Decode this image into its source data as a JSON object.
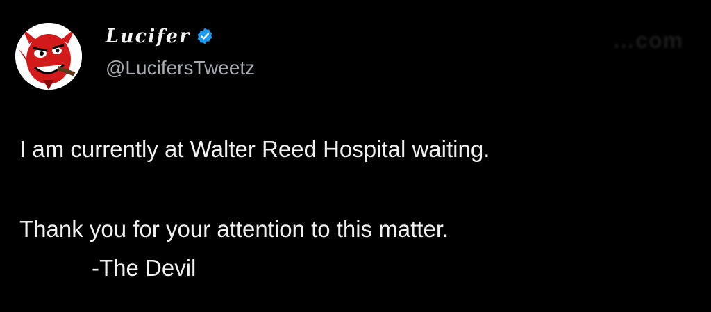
{
  "author": {
    "display_name": "Lucifer",
    "handle": "@LucifersTweetz",
    "avatar_icon": "devil-avatar-icon",
    "verified_icon": "verified-badge-icon",
    "verified_color": "#1d9bf0"
  },
  "watermark": "…com",
  "tweet": {
    "line_1": "I am currently at Walter Reed Hospital waiting.",
    "line_2": "Thank you for your attention to this matter.",
    "signature": "-The Devil"
  },
  "colors": {
    "background": "#000000",
    "text": "#f1f1f1",
    "handle": "#a9adb2"
  }
}
